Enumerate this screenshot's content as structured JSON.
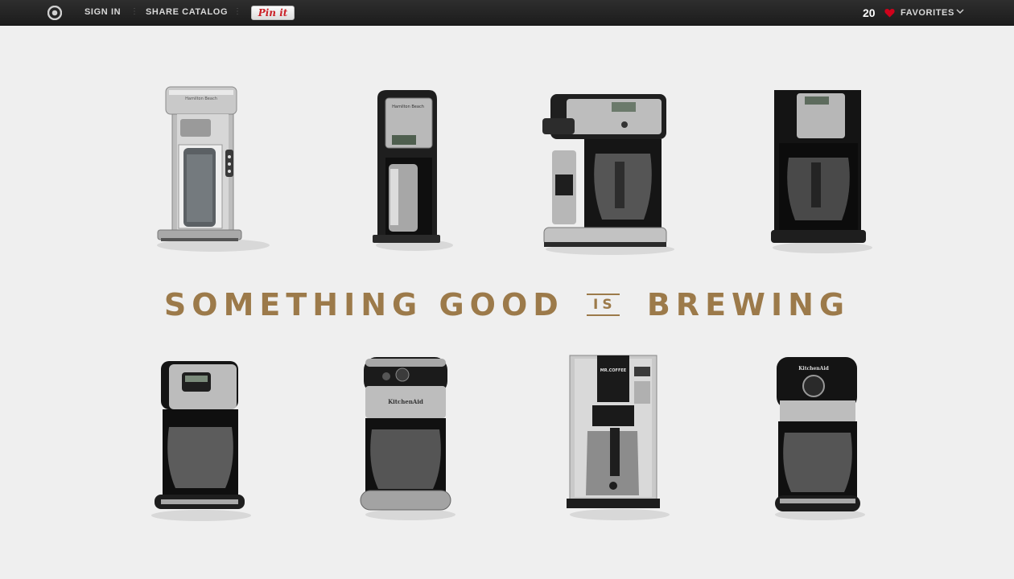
{
  "topbar": {
    "sign_in": "SIGN IN",
    "share_catalog": "SHARE CATALOG",
    "pin_it": "Pin it",
    "favorites_count": "20",
    "favorites_label": "FAVORITES"
  },
  "headline": {
    "part1": "SOMETHING GOOD",
    "part2": "IS",
    "part3": "BREWING"
  },
  "products": {
    "row1": [
      "single-serve-brewer-steel",
      "single-serve-brewer-black",
      "two-way-brewer",
      "black-coffee-maker"
    ],
    "row2": [
      "programmable-coffee-maker",
      "kitchenaid-coffee-maker",
      "mr-coffee-thermal",
      "kitchenaid-round-coffee-maker"
    ]
  },
  "brands": {
    "hamilton": "Hamilton Beach",
    "kitchenaid": "KitchenAid",
    "mrcoffee": "MR.COFFEE"
  },
  "colors": {
    "accent": "#9c7a4a",
    "topbar": "#222222",
    "background": "#efefef",
    "heart": "#d0021b"
  }
}
